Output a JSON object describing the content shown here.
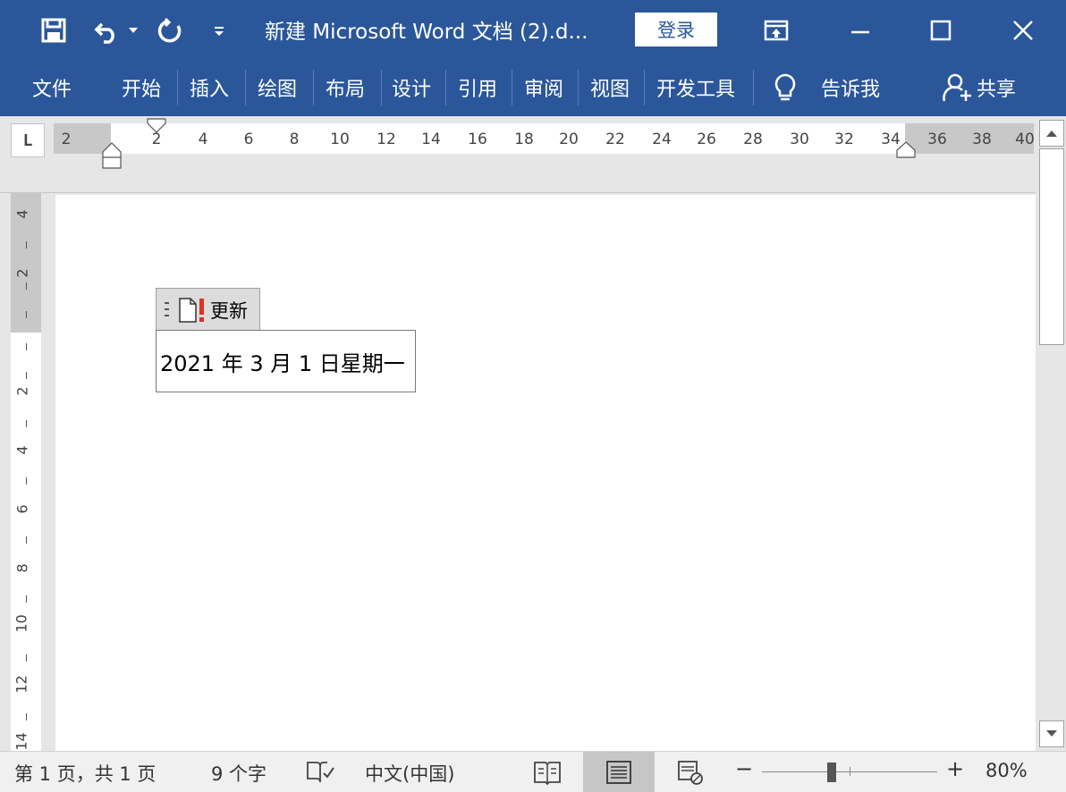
{
  "window": {
    "title": "新建 Microsoft Word 文档 (2).d...",
    "login_label": "登录"
  },
  "ribbon": {
    "tabs": [
      "文件",
      "开始",
      "插入",
      "绘图",
      "布局",
      "设计",
      "引用",
      "审阅",
      "视图",
      "开发工具"
    ],
    "tell_me": "告诉我",
    "share": "共享"
  },
  "ruler": {
    "horizontal_labels": [
      "2",
      "2",
      "4",
      "6",
      "8",
      "10",
      "12",
      "14",
      "16",
      "18",
      "20",
      "22",
      "24",
      "26",
      "28",
      "30",
      "32",
      "34",
      "36",
      "38",
      "40"
    ],
    "vertical_labels": [
      "4",
      "2",
      "2",
      "4",
      "6",
      "8",
      "10",
      "12",
      "14"
    ],
    "tab_selector": "L"
  },
  "field": {
    "update_label": "更新",
    "date_text": "2021 年 3 月 1 日星期一"
  },
  "statusbar": {
    "page_info": "第 1 页，共 1 页",
    "word_count": "9 个字",
    "language": "中文(中国)",
    "zoom_minus": "−",
    "zoom_plus": "+",
    "zoom_level": "80%"
  },
  "icons": {
    "save": "save-icon",
    "undo": "undo-icon",
    "redo": "redo-icon",
    "customize": "customize-qat-icon",
    "ribbon_display": "ribbon-display-options-icon",
    "minimize": "minimize-icon",
    "maximize": "maximize-icon",
    "close": "close-icon",
    "lightbulb": "lightbulb-icon",
    "person": "person-add-icon"
  },
  "colors": {
    "title_bar": "#2b579a",
    "page": "#ffffff"
  }
}
